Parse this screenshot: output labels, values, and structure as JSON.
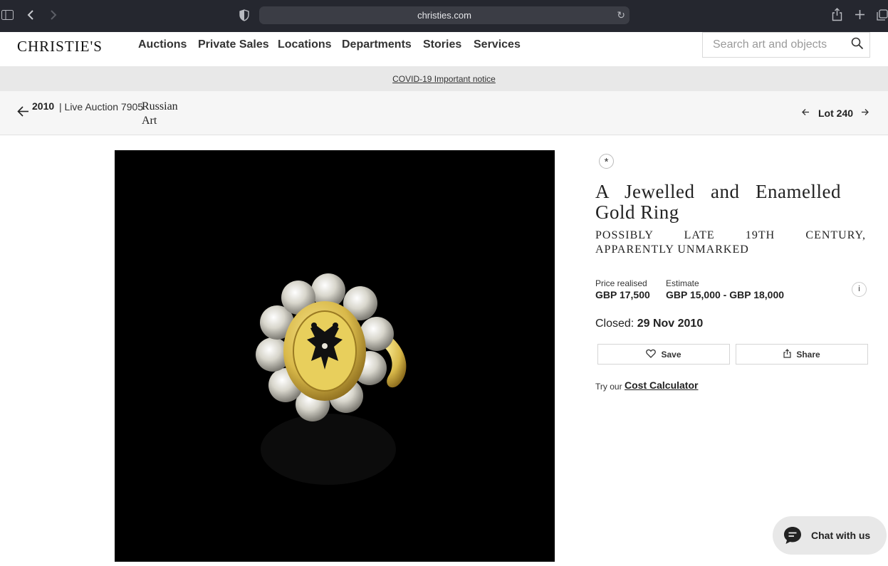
{
  "browser": {
    "url": "christies.com",
    "icons": [
      "sidebar-icon",
      "back-icon",
      "forward-icon",
      "privacy-shield-icon",
      "reload-icon",
      "share-icon",
      "new-tab-icon",
      "tabs-overview-icon"
    ]
  },
  "header": {
    "logo": "CHRISTIE'S",
    "nav": [
      "Auctions",
      "Private Sales",
      "Locations",
      "Departments",
      "Stories",
      "Services"
    ],
    "search_placeholder": "Search art and objects"
  },
  "notice": {
    "label": "COVID-19 Important notice"
  },
  "lotbar": {
    "year": "2010",
    "sale": "| Live Auction 7905",
    "sale_title": "Russian Art",
    "lot_label": "Lot 240"
  },
  "lot": {
    "title": "A Jewelled and Enamelled Gold Ring",
    "subtitle": "Possibly late 19th century, apparently unmarked",
    "price_realised_label": "Price realised",
    "price_realised": "GBP 17,500",
    "estimate_label": "Estimate",
    "estimate": "GBP 15,000 - GBP 18,000",
    "info": "i",
    "closed_label": "Closed:",
    "closed_date": "29 Nov 2010",
    "save_label": "Save",
    "share_label": "Share",
    "try_label": "Try our",
    "calculator_label": "Cost Calculator"
  },
  "chat": {
    "label": "Chat with us"
  },
  "colors": {
    "chrome": "#25272f",
    "notice_bg": "#e8e8e8",
    "lotbar_bg": "#f6f6f6",
    "photo_bg": "#000000",
    "gold": "#d9b94a"
  }
}
